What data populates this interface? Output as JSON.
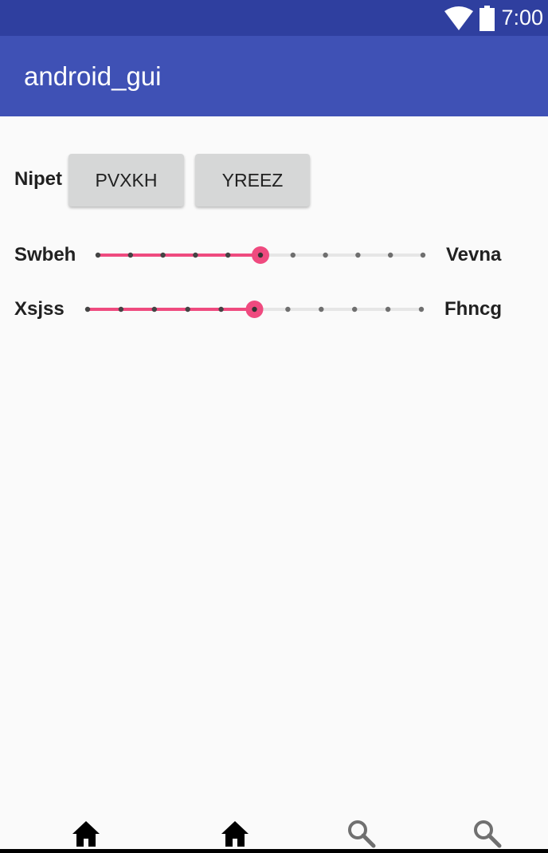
{
  "status_bar": {
    "time": "7:00",
    "wifi_icon": "wifi-icon",
    "battery_icon": "battery-icon"
  },
  "app_bar": {
    "title": "android_gui"
  },
  "button_row": {
    "label": "Nipet",
    "buttons": [
      "PVXKH",
      "YREEZ"
    ]
  },
  "seekbars": [
    {
      "left_label": "Swbeh",
      "right_label": "Vevna",
      "ticks": 11,
      "value_index": 5
    },
    {
      "left_label": "Xsjss",
      "right_label": "Fhncg",
      "ticks": 11,
      "value_index": 5
    }
  ],
  "bottom_nav": {
    "items": [
      {
        "icon": "home-icon"
      },
      {
        "icon": "home-icon"
      },
      {
        "icon": "search-icon"
      },
      {
        "icon": "search-icon"
      }
    ]
  },
  "colors": {
    "status_bar": "#2f3f9f",
    "app_bar": "#3f51b5",
    "accent": "#ef4a7f",
    "button": "#d6d7d7",
    "background": "#fafafa"
  }
}
